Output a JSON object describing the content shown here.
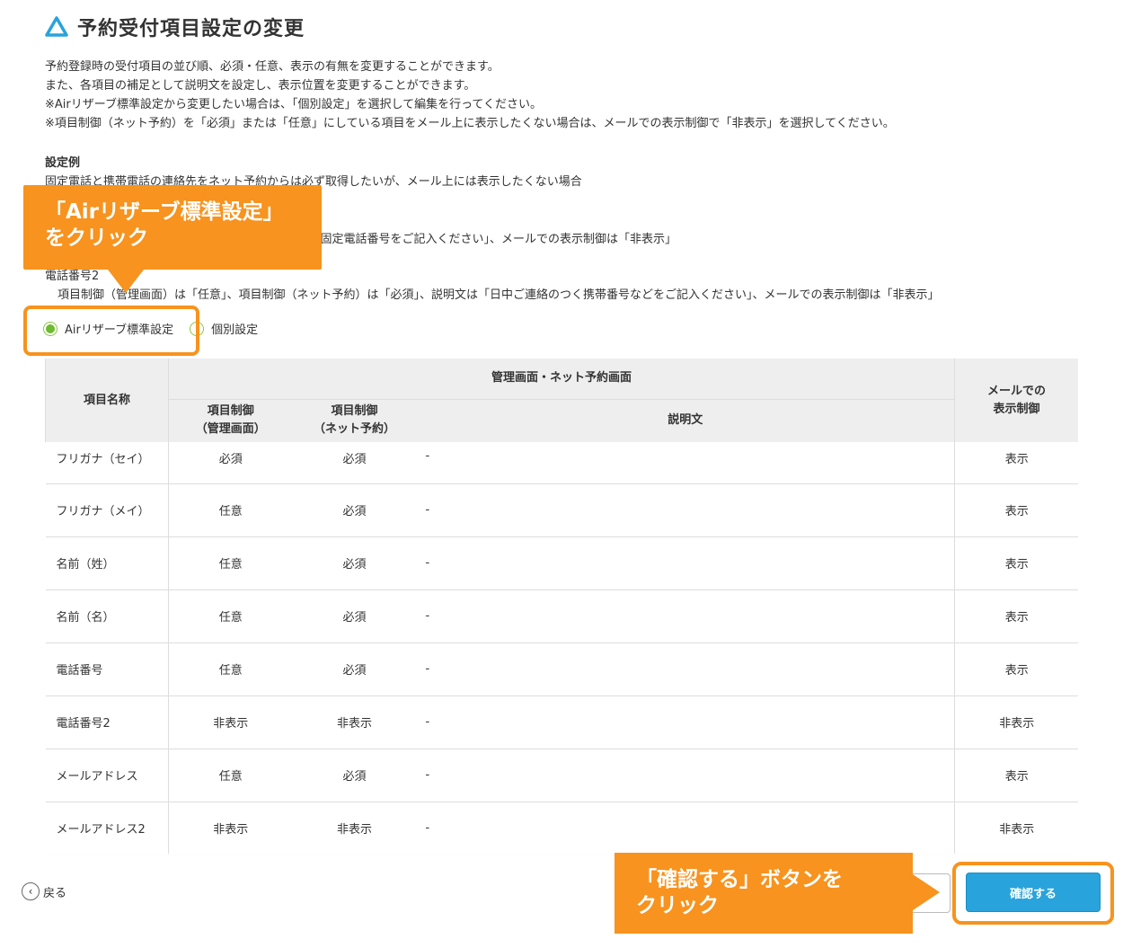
{
  "header": {
    "title": "予約受付項目設定の変更",
    "icon": "triangle-logo-icon",
    "accent": "#29a3db"
  },
  "description": {
    "lines": [
      "予約登録時の受付項目の並び順、必須・任意、表示の有無を変更することができます。",
      "また、各項目の補足として説明文を設定し、表示位置を変更することができます。",
      "※Airリザーブ標準設定から変更したい場合は、「個別設定」を選択して編集を行ってください。",
      "※項目制御（ネット予約）を「必須」または「任意」にしている項目をメール上に表示したくない場合は、メールでの表示制御で「非表示」を選択してください。"
    ]
  },
  "example": {
    "heading": "設定例",
    "text": "固定電話と携帯電話の連絡先をネット予約からは必ず取得したいが、メール上には表示したくない場合",
    "line1": "ネット予約）は「必須」、説明文は「ご自宅などの固定電話番号をご記入ください」、メールでの表示制御は「非表示」",
    "label2": "電話番号2",
    "line2": "項目制御（管理画面）は「任意」、項目制御（ネット予約）は「必須」、説明文は「日中ご連絡のつく携帯番号などをご記入ください」、メールでの表示制御は「非表示」"
  },
  "mode": {
    "standard_label": "Airリザーブ標準設定",
    "custom_label": "個別設定",
    "selected": "standard"
  },
  "table": {
    "headers": {
      "name": "項目名称",
      "group": "管理画面・ネット予約画面",
      "admin": "項目制御\n（管理画面）",
      "net": "項目制御\n（ネット予約）",
      "desc": "説明文",
      "mail": "メールでの\n表示制御"
    },
    "rows": [
      {
        "name": "フリガナ（セイ）",
        "admin": "必須",
        "net": "必須",
        "desc": "-",
        "mail": "表示"
      },
      {
        "name": "フリガナ（メイ）",
        "admin": "任意",
        "net": "必須",
        "desc": "-",
        "mail": "表示"
      },
      {
        "name": "名前（姓）",
        "admin": "任意",
        "net": "必須",
        "desc": "-",
        "mail": "表示"
      },
      {
        "name": "名前（名）",
        "admin": "任意",
        "net": "必須",
        "desc": "-",
        "mail": "表示"
      },
      {
        "name": "電話番号",
        "admin": "任意",
        "net": "必須",
        "desc": "-",
        "mail": "表示"
      },
      {
        "name": "電話番号2",
        "admin": "非表示",
        "net": "非表示",
        "desc": "-",
        "mail": "非表示"
      },
      {
        "name": "メールアドレス",
        "admin": "任意",
        "net": "必須",
        "desc": "-",
        "mail": "表示"
      },
      {
        "name": "メールアドレス2",
        "admin": "非表示",
        "net": "非表示",
        "desc": "-",
        "mail": "非表示"
      }
    ]
  },
  "footer": {
    "back_label": "戻る",
    "confirm_label": "確認する"
  },
  "callouts": {
    "radio_hint": "「Airリザーブ標準設定」\nをクリック",
    "confirm_hint": "「確認する」ボタンを\nクリック",
    "color": "#f7931e"
  }
}
